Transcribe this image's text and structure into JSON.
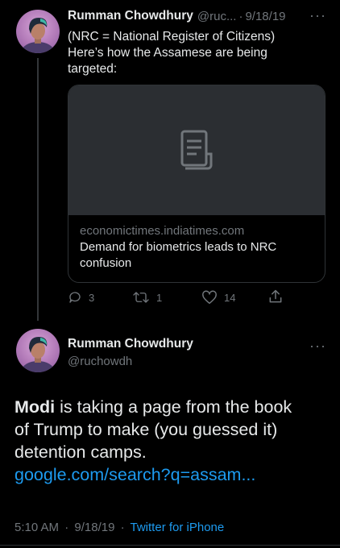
{
  "tweet1": {
    "author_name": "Rumman Chowdhury",
    "handle_truncated": "@ruc...",
    "separator": "·",
    "date": "9/18/19",
    "more": "···",
    "text_lines": [
      "(NRC = National Register of Citizens)",
      "Here’s how the Assamese are being",
      "targeted:"
    ],
    "card": {
      "domain": "economictimes.indiatimes.com",
      "title_lines": [
        "Demand for biometrics leads to NRC",
        "confusion"
      ],
      "image_icon": "document-icon"
    },
    "actions": {
      "replies": "3",
      "retweets": "1",
      "likes": "14"
    }
  },
  "tweet2": {
    "author_name": "Rumman Chowdhury",
    "handle": "@ruchowdh",
    "more": "···",
    "text_bold": "Modi",
    "text_lines": [
      " is taking a page from the book",
      "of Trump to make (you guessed it)",
      "detention camps."
    ],
    "link": "google.com/search?q=assam...",
    "time": "5:10 AM",
    "separator": "·",
    "date": "9/18/19",
    "source": "Twitter for iPhone"
  },
  "colors": {
    "background": "#000000",
    "text": "#e7e9ea",
    "muted": "#71767b",
    "link": "#1d9bf0",
    "card_image": "#2b2e32"
  }
}
